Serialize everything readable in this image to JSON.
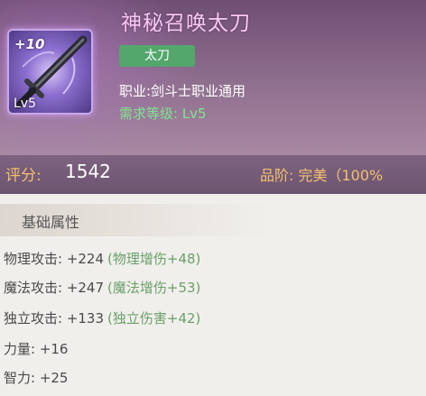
{
  "item": {
    "name": "神秘召唤太刀",
    "type_badge": "太刀",
    "class_line": "职业:剑斗士职业通用",
    "requirement_line": "需求等级: Lv5",
    "icon_plus": "+10",
    "icon_level": "Lv5"
  },
  "score": {
    "label": "评分:",
    "value": "1542",
    "grade": "品阶: 完美（100%"
  },
  "section": {
    "title": "基础属性"
  },
  "attributes": [
    {
      "label": "物理攻击: +224",
      "bonus": "(物理增伤+48)"
    },
    {
      "label": "魔法攻击: +247",
      "bonus": "(魔法增伤+53)"
    },
    {
      "label": "独立攻击: +133",
      "bonus": "(独立伤害+42)"
    },
    {
      "label": "力量: +16",
      "bonus": ""
    },
    {
      "label": "智力: +25",
      "bonus": ""
    }
  ],
  "colors": {
    "name": "#f7c9f3",
    "badge": "#53a76c",
    "requirement": "#7fe48f",
    "score_label": "#f0c070",
    "bonus": "#6aa06a"
  }
}
